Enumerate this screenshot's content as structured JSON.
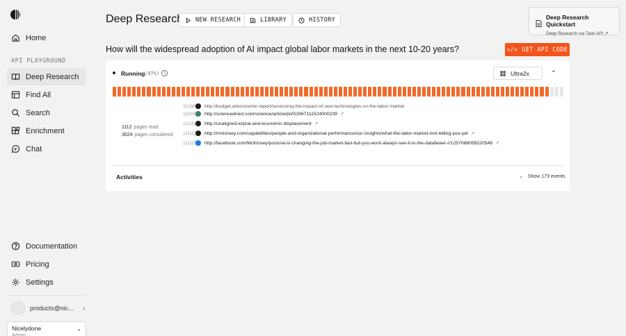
{
  "sidebar": {
    "items": [
      {
        "label": "Home",
        "icon": "home-icon"
      },
      {
        "label": "Deep Research",
        "icon": "book-icon",
        "active": true
      },
      {
        "label": "Find All",
        "icon": "table-icon"
      },
      {
        "label": "Search",
        "icon": "search-icon"
      },
      {
        "label": "Enrichment",
        "icon": "blocks-icon"
      },
      {
        "label": "Chat",
        "icon": "chat-icon"
      }
    ],
    "section_label": "API PLAYGROUND",
    "bottom_items": [
      {
        "label": "Documentation",
        "icon": "help-icon"
      },
      {
        "label": "Pricing",
        "icon": "money-icon"
      },
      {
        "label": "Settings",
        "icon": "gear-icon"
      }
    ],
    "user": {
      "email": "products@nic..."
    },
    "org": {
      "name": "Nicelydone",
      "role": "Admin"
    }
  },
  "header": {
    "title": "Deep Research",
    "buttons": [
      {
        "label": "NEW RESEARCH",
        "icon": "play-icon"
      },
      {
        "label": "LIBRARY",
        "icon": "library-icon"
      },
      {
        "label": "HISTORY",
        "icon": "clock-icon"
      }
    ],
    "quickstart": {
      "title": "Deep Research Quickstart",
      "subtitle": "Deep Research via Task API"
    }
  },
  "question": "How will the widespread adoption of AI impact global labor markets in the next 10-20 years?",
  "api_button": {
    "label": "GET API CODE",
    "icon": "code-icon"
  },
  "task": {
    "status": "Running",
    "percent_label": "(97%)",
    "progress": 0.97,
    "model": "Ultra2x",
    "pages_read": "1112",
    "pages_read_label": "pages read",
    "pages_considered": "3024",
    "pages_considered_label": "pages considered",
    "links": [
      {
        "idx": "[1108]",
        "url": "http://budget.ai/economic-report/assessing-the-impact-of-new-technologies-on-the-labor-market",
        "fav": "dark"
      },
      {
        "idx": "[1109]",
        "url": "http://sciencedirect.com/science/article/pii/S2667111524000239",
        "fav": "green"
      },
      {
        "idx": "[1110]",
        "url": "http://unaligned.io/p/ai-and-economic-displacement",
        "fav": "dark"
      },
      {
        "idx": "[1111]",
        "url": "http://mckinsey.com/capabilities/people-and-organizational-performance/our-insights/what-the-labor-market-isnt-telling-you-yet",
        "fav": "dark"
      },
      {
        "idx": "[1112]",
        "url": "http://facebook.com/McKinsey/posts/ai-is-changing-the-job-market-fast-but-you-wont-always-see-it-in-the-datafewer-r/1257088059220548",
        "fav": "blue"
      }
    ],
    "activities_label": "Activities",
    "show_events": "Show 179 events"
  },
  "colors": {
    "accent": "#f2541b",
    "progress": "#f26a2a",
    "active_nav": "#e6e6e4"
  }
}
